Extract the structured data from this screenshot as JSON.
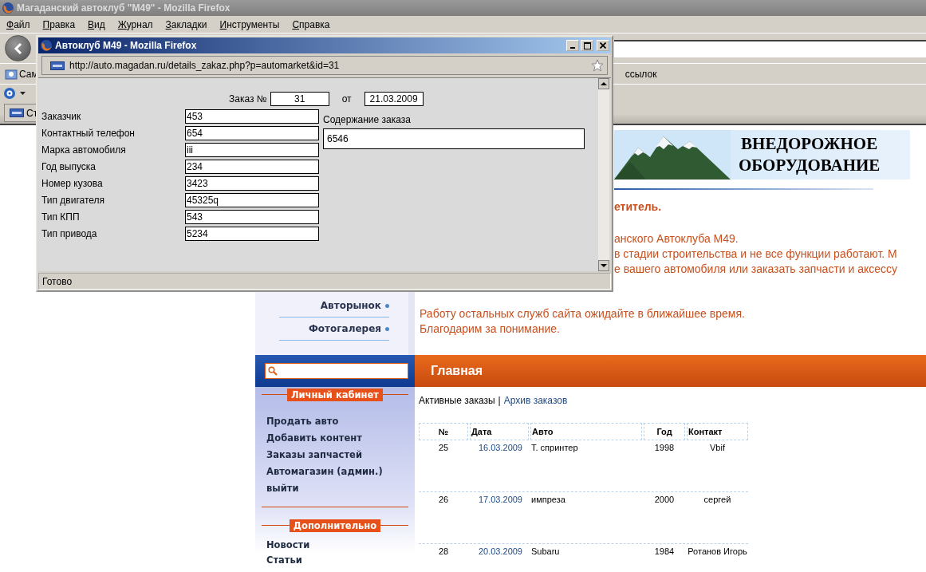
{
  "browser": {
    "title": "Магаданский автоклуб \"M49\" - Mozilla Firefox",
    "menu": [
      "Файл",
      "Правка",
      "Вид",
      "Журнал",
      "Закладки",
      "Инструменты",
      "Справка"
    ],
    "bookmarks": [
      "Сам",
      "ссылок"
    ],
    "tab": {
      "label": "Ст"
    }
  },
  "popup": {
    "title": "Автоклуб M49 - Mozilla Firefox",
    "url": "http://auto.magadan.ru/details_zakaz.php?p=automarket&id=31",
    "order": {
      "number_label": "Заказ №",
      "number": "31",
      "date_label": "от",
      "date": "21.03.2009"
    },
    "fields": [
      {
        "label": "Заказчик",
        "value": "453"
      },
      {
        "label": "Контактный телефон",
        "value": "654"
      },
      {
        "label": "Марка автомобиля",
        "value": "iii"
      },
      {
        "label": "Год выпуска",
        "value": "234"
      },
      {
        "label": "Номер кузова",
        "value": "3423"
      },
      {
        "label": "Тип двигателя",
        "value": "45325q"
      },
      {
        "label": "Тип КПП",
        "value": "543"
      },
      {
        "label": "Тип привода",
        "value": "5234"
      }
    ],
    "content_label": "Содержание заказа",
    "content": "6546",
    "status": "Готово"
  },
  "site": {
    "banner_title": [
      "ВНЕДОРОЖНОЕ",
      "ОБОРУДОВАНИЕ"
    ],
    "greeting": "етитель.",
    "intro_lines": [
      "анского Автоклуба М49.",
      "в стадии строительства и не все функции работают. М",
      "е вашего автомобиля или заказать запчасти и аксессу"
    ],
    "notice_lines": [
      "Работу остальных служб сайта ожидайте в ближайшее время.",
      "Благодарим за понимание."
    ],
    "nav": [
      "Авторынок",
      "Фотогалерея"
    ],
    "sections": [
      {
        "title": "Личный кабинет",
        "items": [
          "Продать авто",
          "Добавить контент",
          "Заказы запчастей",
          "Автомагазин (админ.)",
          "выйти"
        ]
      },
      {
        "title": "Дополнительно",
        "items": [
          "Новости",
          "Статьи"
        ]
      }
    ],
    "page_title": "Главная",
    "tabs": [
      {
        "label": "Активные заказы",
        "selected": true
      },
      {
        "label": "Архив заказов",
        "selected": false
      }
    ],
    "tab_separator": "|",
    "table": {
      "columns": [
        "№",
        "Дата",
        "Авто",
        "Год",
        "Контакт"
      ],
      "rows": [
        [
          "25",
          "16.03.2009",
          "Т. спринтер",
          "1998",
          "Vbif"
        ],
        [
          "26",
          "17.03.2009",
          "импреза",
          "2000",
          "сергей"
        ],
        [
          "28",
          "20.03.2009",
          "Subaru",
          "1984",
          "Ротанов Игорь"
        ]
      ]
    }
  }
}
